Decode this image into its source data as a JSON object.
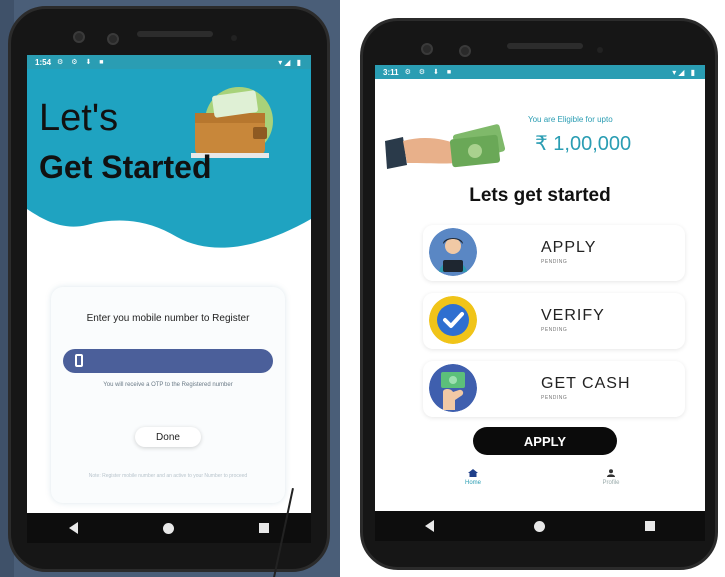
{
  "left_phone": {
    "status": {
      "time": "1:54",
      "icons": "⚙ ⚙ ⬇ ■",
      "right": "▾◢ ▮"
    },
    "hero": {
      "line1": "Let's",
      "line2": "Get Started"
    },
    "register": {
      "label": "Enter you mobile number to Register",
      "input_value": "",
      "otp_note": "You will receive a OTP to the Registered number",
      "done_label": "Done",
      "fine_print": "Note: Register mobile number and an active to your Number to proceed"
    }
  },
  "right_phone": {
    "status": {
      "time": "3:11",
      "icons": "⚙ ⚙ ⬇ ■",
      "right": "▾◢ ▮"
    },
    "eligible_label": "You are Eligible for upto",
    "eligible_amount": "₹ 1,00,000",
    "section_title": "Lets get started",
    "steps": [
      {
        "title": "APPLY",
        "status": "PENDING",
        "icon": "person-laptop-icon",
        "color": "#5a87c4"
      },
      {
        "title": "VERIFY",
        "status": "PENDING",
        "icon": "checkmark-icon",
        "color": "#f0c419"
      },
      {
        "title": "GET CASH",
        "status": "PENDING",
        "icon": "cash-hand-icon",
        "color": "#3f5fae"
      }
    ],
    "apply_button": "APPLY",
    "tabs": [
      {
        "label": "Home",
        "icon": "home-icon"
      },
      {
        "label": "Profile",
        "icon": "profile-icon"
      }
    ]
  },
  "colors": {
    "accent": "#2a9db3",
    "input": "#4b5f9a",
    "background_left": "#4a5e78"
  }
}
